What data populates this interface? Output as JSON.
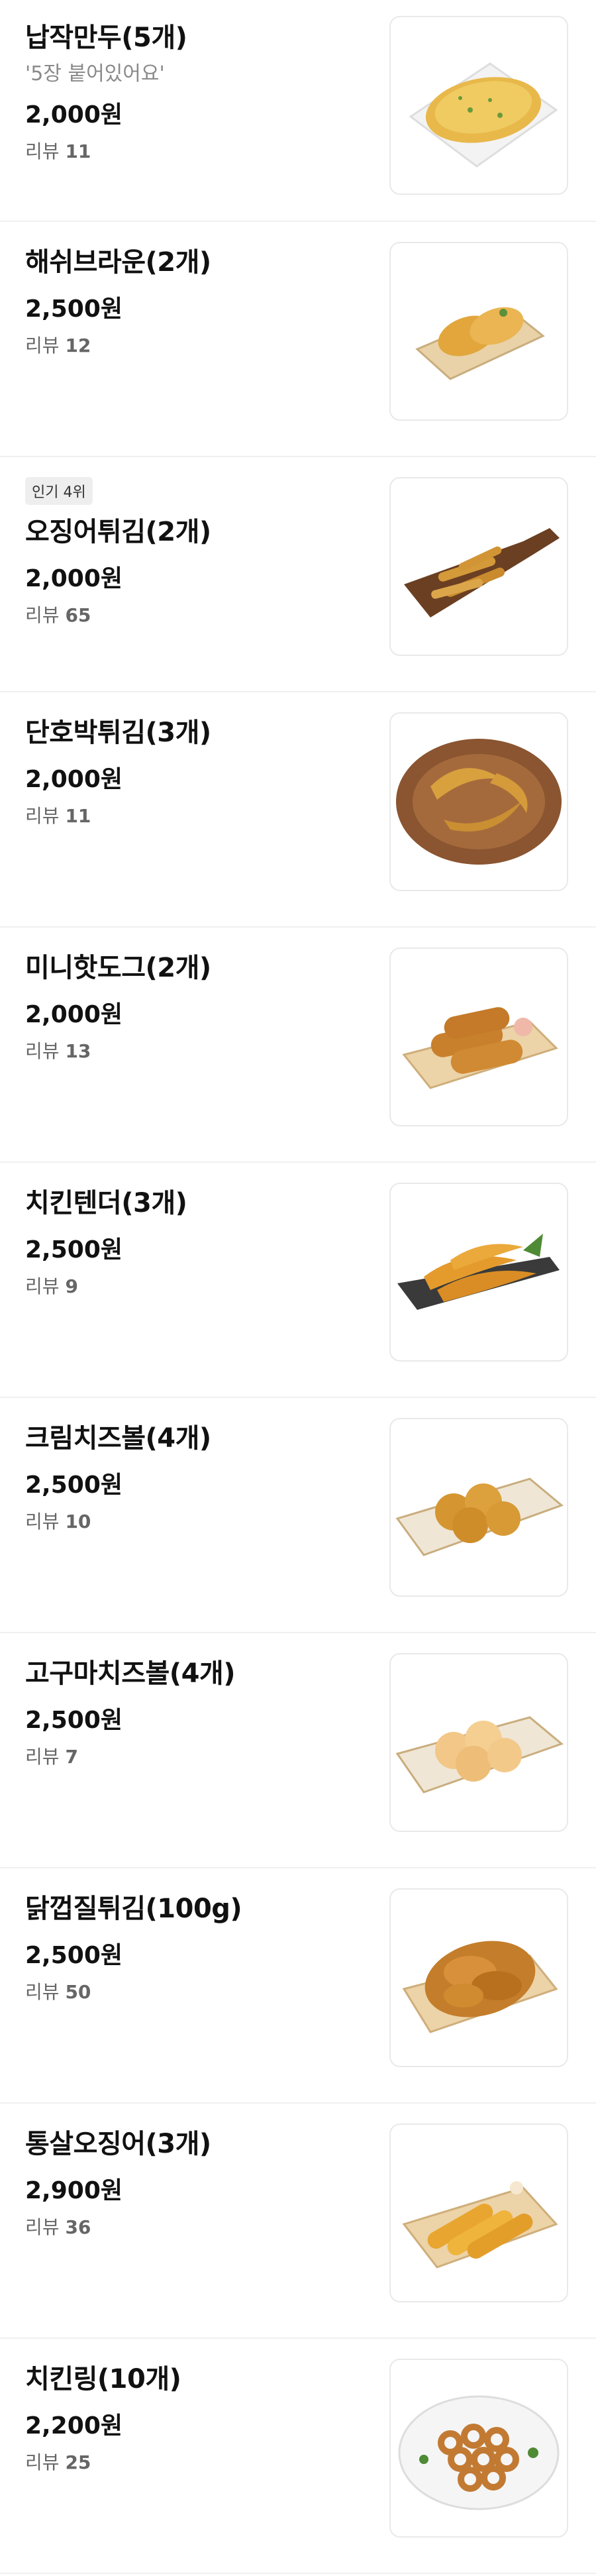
{
  "menu": {
    "items": [
      {
        "name": "납작만두(5개)",
        "desc": "'5장 붙어있어요'",
        "price": "2,000원",
        "review_label": "리뷰",
        "review_count": "11"
      },
      {
        "name": "해쉬브라운(2개)",
        "price": "2,500원",
        "review_label": "리뷰",
        "review_count": "12"
      },
      {
        "badge": "인기 4위",
        "name": "오징어튀김(2개)",
        "price": "2,000원",
        "review_label": "리뷰",
        "review_count": "65"
      },
      {
        "name": "단호박튀김(3개)",
        "price": "2,000원",
        "review_label": "리뷰",
        "review_count": "11"
      },
      {
        "name": "미니핫도그(2개)",
        "price": "2,000원",
        "review_label": "리뷰",
        "review_count": "13"
      },
      {
        "name": "치킨텐더(3개)",
        "price": "2,500원",
        "review_label": "리뷰",
        "review_count": "9"
      },
      {
        "name": "크림치즈볼(4개)",
        "price": "2,500원",
        "review_label": "리뷰",
        "review_count": "10"
      },
      {
        "name": "고구마치즈볼(4개)",
        "price": "2,500원",
        "review_label": "리뷰",
        "review_count": "7"
      },
      {
        "name": "닭껍질튀김(100g)",
        "price": "2,500원",
        "review_label": "리뷰",
        "review_count": "50"
      },
      {
        "name": "통살오징어(3개)",
        "price": "2,900원",
        "review_label": "리뷰",
        "review_count": "36"
      },
      {
        "name": "치킨링(10개)",
        "price": "2,200원",
        "review_label": "리뷰",
        "review_count": "25"
      }
    ]
  },
  "images": [
    "flat-dumplings-photo",
    "hash-brown-photo",
    "squid-tempura-photo",
    "pumpkin-tempura-photo",
    "mini-hotdog-photo",
    "chicken-tender-photo",
    "cream-cheese-ball-photo",
    "sweet-potato-cheese-ball-photo",
    "chicken-skin-fries-photo",
    "squid-sticks-photo",
    "chicken-ring-photo"
  ],
  "colors": {
    "text": "#111111",
    "desc": "#8a8a8a",
    "review": "#666666",
    "divider": "#f0f0f0",
    "badge_bg": "#eeeeee",
    "fried": "#d9932f"
  }
}
